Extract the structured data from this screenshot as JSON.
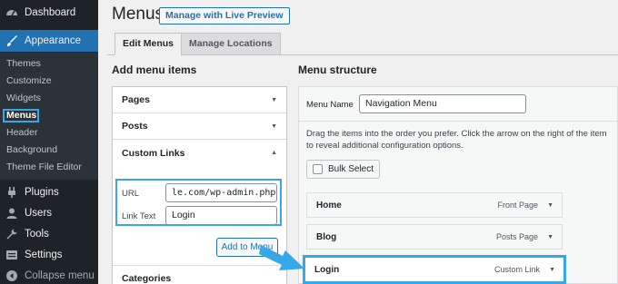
{
  "sidebar": {
    "dashboard": "Dashboard",
    "appearance": "Appearance",
    "sub": [
      "Themes",
      "Customize",
      "Widgets",
      "Menus",
      "Header",
      "Background",
      "Theme File Editor"
    ],
    "plugins": "Plugins",
    "users": "Users",
    "tools": "Tools",
    "settings": "Settings",
    "collapse": "Collapse menu"
  },
  "header": {
    "title": "Menus",
    "live_preview": "Manage with Live Preview"
  },
  "tabs": [
    "Edit Menus",
    "Manage Locations"
  ],
  "add_items": {
    "heading": "Add menu items",
    "sections": [
      "Pages",
      "Posts",
      "Custom Links",
      "Categories"
    ],
    "url_label": "URL",
    "url_value": "le.com/wp-admin.php",
    "link_text_label": "Link Text",
    "link_text_value": "Login",
    "add_button": "Add to Menu"
  },
  "structure": {
    "heading": "Menu structure",
    "menu_name_label": "Menu Name",
    "menu_name_value": "Navigation Menu",
    "instructions": "Drag the items into the order you prefer. Click the arrow on the right of the item to reveal additional configuration options.",
    "bulk_select": "Bulk Select",
    "items": [
      {
        "title": "Home",
        "type": "Front Page"
      },
      {
        "title": "Blog",
        "type": "Posts Page"
      },
      {
        "title": "Login",
        "type": "Custom Link"
      }
    ]
  },
  "colors": {
    "sidebar_bg": "#1d2327",
    "accent": "#2271b1",
    "highlight": "#36a7e7"
  }
}
